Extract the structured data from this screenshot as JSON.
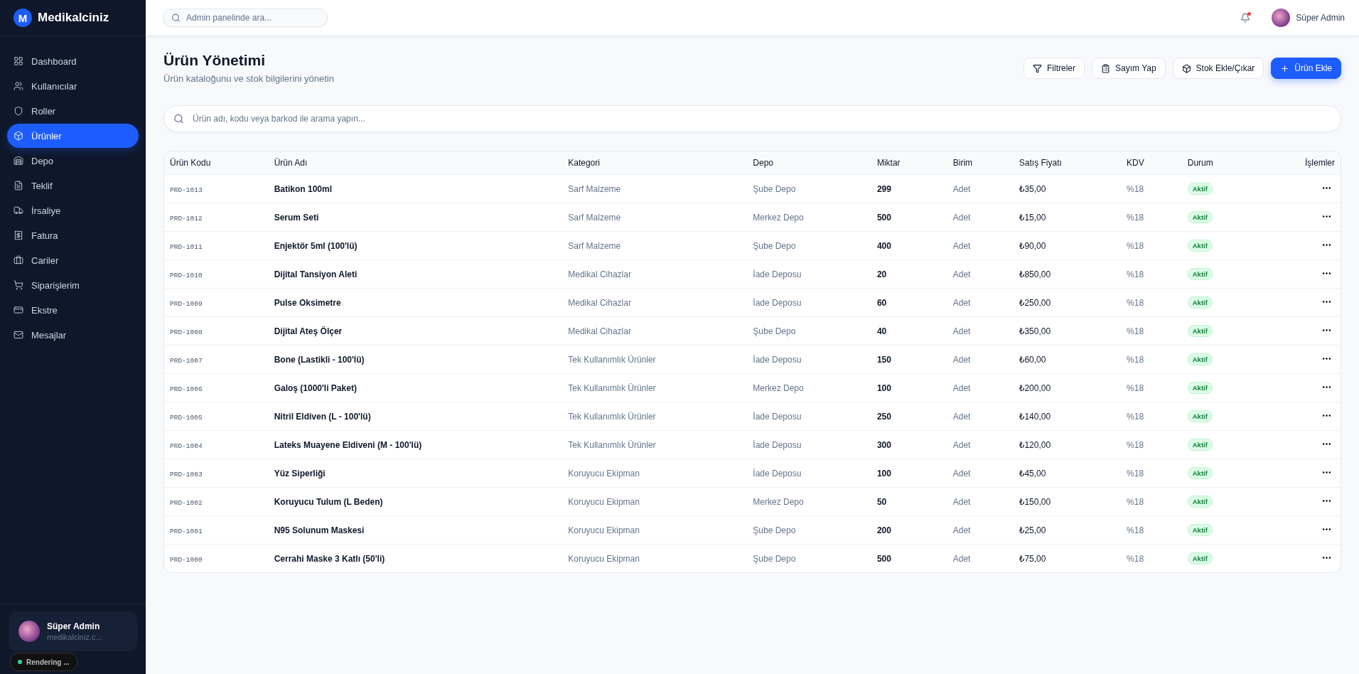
{
  "brand": {
    "logo_letter": "M",
    "name": "Medikalciniz"
  },
  "sidebar": {
    "items": [
      {
        "label": "Dashboard",
        "selected": false
      },
      {
        "label": "Kullanıcılar",
        "selected": false
      },
      {
        "label": "Roller",
        "selected": false
      },
      {
        "label": "Ürünler",
        "selected": true
      },
      {
        "label": "Depo",
        "selected": false
      },
      {
        "label": "Teklif",
        "selected": false
      },
      {
        "label": "İrsaliye",
        "selected": false
      },
      {
        "label": "Fatura",
        "selected": false
      },
      {
        "label": "Cariler",
        "selected": false
      },
      {
        "label": "Siparişlerim",
        "selected": false
      },
      {
        "label": "Ekstre",
        "selected": false
      },
      {
        "label": "Mesajlar",
        "selected": false
      }
    ],
    "user": {
      "name": "Süper Admin",
      "email": "medikalciniz.c..."
    },
    "toast": {
      "text": "Rendering ..."
    }
  },
  "header": {
    "search": {
      "placeholder": "Admin panelinde ara..."
    },
    "notification_dot": true,
    "user_name": "Süper Admin"
  },
  "page": {
    "title": "Ürün Yönetimi",
    "subtitle": "Ürün kataloğunu ve stok bilgilerini yönetin",
    "actions": [
      {
        "label": "Filtreler",
        "kind": "outline"
      },
      {
        "label": "Sayım Yap",
        "kind": "outline"
      },
      {
        "label": "Stok Ekle/Çıkar",
        "kind": "outline"
      },
      {
        "label": "Ürün Ekle",
        "kind": "primary"
      }
    ],
    "search": {
      "placeholder": "Ürün adı, kodu veya barkod ile arama yapın..."
    }
  },
  "table": {
    "columns": [
      "Ürün Kodu",
      "Ürün Adı",
      "Kategori",
      "Depo",
      "Miktar",
      "Birim",
      "Satış Fiyatı",
      "KDV",
      "Durum",
      "İşlemler"
    ],
    "rows": [
      {
        "code": "PRD-1013",
        "name": "Batikon 100ml",
        "category": "Sarf Malzeme",
        "depot": "Şube Depo",
        "qty": "299",
        "unit": "Adet",
        "price": "₺35,00",
        "vat": "%18",
        "status": "Aktif"
      },
      {
        "code": "PRD-1012",
        "name": "Serum Seti",
        "category": "Sarf Malzeme",
        "depot": "Merkez Depo",
        "qty": "500",
        "unit": "Adet",
        "price": "₺15,00",
        "vat": "%18",
        "status": "Aktif"
      },
      {
        "code": "PRD-1011",
        "name": "Enjektör 5ml (100'lü)",
        "category": "Sarf Malzeme",
        "depot": "Şube Depo",
        "qty": "400",
        "unit": "Adet",
        "price": "₺90,00",
        "vat": "%18",
        "status": "Aktif"
      },
      {
        "code": "PRD-1010",
        "name": "Dijital Tansiyon Aleti",
        "category": "Medikal Cihazlar",
        "depot": "İade Deposu",
        "qty": "20",
        "unit": "Adet",
        "price": "₺850,00",
        "vat": "%18",
        "status": "Aktif"
      },
      {
        "code": "PRD-1009",
        "name": "Pulse Oksimetre",
        "category": "Medikal Cihazlar",
        "depot": "İade Deposu",
        "qty": "60",
        "unit": "Adet",
        "price": "₺250,00",
        "vat": "%18",
        "status": "Aktif"
      },
      {
        "code": "PRD-1008",
        "name": "Dijital Ateş Ölçer",
        "category": "Medikal Cihazlar",
        "depot": "Şube Depo",
        "qty": "40",
        "unit": "Adet",
        "price": "₺350,00",
        "vat": "%18",
        "status": "Aktif"
      },
      {
        "code": "PRD-1007",
        "name": "Bone (Lastikli - 100'lü)",
        "category": "Tek Kullanımlık Ürünler",
        "depot": "İade Deposu",
        "qty": "150",
        "unit": "Adet",
        "price": "₺60,00",
        "vat": "%18",
        "status": "Aktif"
      },
      {
        "code": "PRD-1006",
        "name": "Galoş (1000'li Paket)",
        "category": "Tek Kullanımlık Ürünler",
        "depot": "Merkez Depo",
        "qty": "100",
        "unit": "Adet",
        "price": "₺200,00",
        "vat": "%18",
        "status": "Aktif"
      },
      {
        "code": "PRD-1005",
        "name": "Nitril Eldiven (L - 100'lü)",
        "category": "Tek Kullanımlık Ürünler",
        "depot": "İade Deposu",
        "qty": "250",
        "unit": "Adet",
        "price": "₺140,00",
        "vat": "%18",
        "status": "Aktif"
      },
      {
        "code": "PRD-1004",
        "name": "Lateks Muayene Eldiveni (M - 100'lü)",
        "category": "Tek Kullanımlık Ürünler",
        "depot": "İade Deposu",
        "qty": "300",
        "unit": "Adet",
        "price": "₺120,00",
        "vat": "%18",
        "status": "Aktif"
      },
      {
        "code": "PRD-1003",
        "name": "Yüz Siperliği",
        "category": "Koruyucu Ekipman",
        "depot": "İade Deposu",
        "qty": "100",
        "unit": "Adet",
        "price": "₺45,00",
        "vat": "%18",
        "status": "Aktif"
      },
      {
        "code": "PRD-1002",
        "name": "Koruyucu Tulum (L Beden)",
        "category": "Koruyucu Ekipman",
        "depot": "Merkez Depo",
        "qty": "50",
        "unit": "Adet",
        "price": "₺150,00",
        "vat": "%18",
        "status": "Aktif"
      },
      {
        "code": "PRD-1001",
        "name": "N95 Solunum Maskesi",
        "category": "Koruyucu Ekipman",
        "depot": "Şube Depo",
        "qty": "200",
        "unit": "Adet",
        "price": "₺25,00",
        "vat": "%18",
        "status": "Aktif"
      },
      {
        "code": "PRD-1000",
        "name": "Cerrahi Maske 3 Katlı (50'li)",
        "category": "Koruyucu Ekipman",
        "depot": "Şube Depo",
        "qty": "500",
        "unit": "Adet",
        "price": "₺75,00",
        "vat": "%18",
        "status": "Aktif"
      }
    ]
  }
}
